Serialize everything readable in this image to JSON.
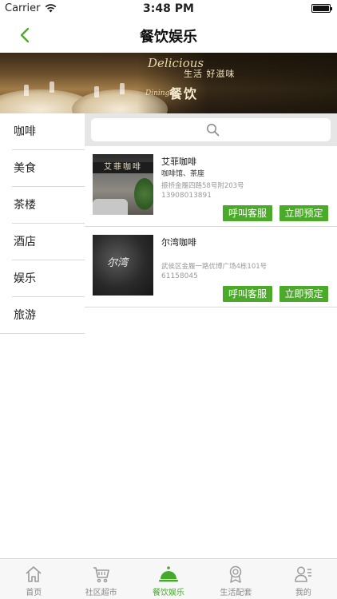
{
  "status_bar": {
    "carrier": "Carrier",
    "time": "3:48 PM"
  },
  "nav": {
    "title": "餐饮娱乐"
  },
  "banner": {
    "english": "Delicious",
    "tagline": "生活 好滋味",
    "dining": "Dining",
    "chinese": "餐饮"
  },
  "side_menu": {
    "items": [
      {
        "label": "咖啡"
      },
      {
        "label": "美食"
      },
      {
        "label": "茶楼"
      },
      {
        "label": "酒店"
      },
      {
        "label": "娱乐"
      },
      {
        "label": "旅游"
      }
    ]
  },
  "search": {
    "placeholder": ""
  },
  "shops": [
    {
      "name": "艾菲咖啡",
      "tags": "咖啡馆、茶座",
      "address": "振桥金履四路58号附203号",
      "phone": "13908013891",
      "image_sign": "艾菲咖啡",
      "call_label": "呼叫客服",
      "book_label": "立即预定"
    },
    {
      "name": "尔湾咖啡",
      "tags": "",
      "address": "武侯区金履一路优博广场4栋101号",
      "phone": "61158045",
      "image_sign": "尔湾",
      "call_label": "呼叫客服",
      "book_label": "立即预定"
    }
  ],
  "tab_bar": {
    "tabs": [
      {
        "label": "首页",
        "icon": "home-icon"
      },
      {
        "label": "社区超市",
        "icon": "cart-icon"
      },
      {
        "label": "餐饮娱乐",
        "icon": "dish-cover-icon",
        "active": true
      },
      {
        "label": "生活配套",
        "icon": "badge-icon"
      },
      {
        "label": "我的",
        "icon": "profile-icon"
      }
    ]
  },
  "colors": {
    "accent": "#4caa2a",
    "tab_active": "#45a92b"
  }
}
